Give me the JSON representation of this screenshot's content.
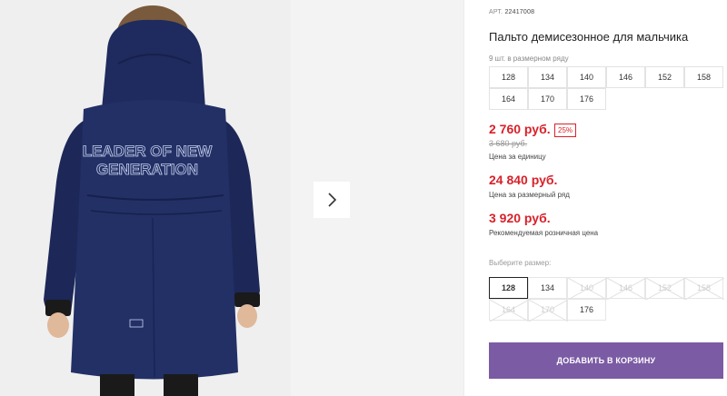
{
  "gallery": {
    "print_line1": "LEADER OF NEW",
    "print_line2": "GENERATION",
    "next_icon": "chevron-right-icon"
  },
  "product": {
    "art_label": "АРТ.",
    "art_number": "22417008",
    "title": "Пальто демисезонное для мальчика",
    "qty_note": "9 шт. в размерном ряду",
    "sizes": [
      "128",
      "134",
      "140",
      "146",
      "152",
      "158",
      "164",
      "170",
      "176"
    ]
  },
  "pricing": {
    "unit_price": "2 760 руб.",
    "discount": "25%",
    "old_price": "3 680 руб.",
    "unit_caption": "Цена за единицу",
    "row_price": "24 840 руб.",
    "row_caption": "Цена за размерный ряд",
    "retail_price": "3 920 руб.",
    "retail_caption": "Рекомендуемая розничная цена",
    "accent_color": "#d8212a"
  },
  "size_picker": {
    "label": "Выберите размер:",
    "options": [
      {
        "size": "128",
        "state": "selected"
      },
      {
        "size": "134",
        "state": "available"
      },
      {
        "size": "140",
        "state": "unavailable"
      },
      {
        "size": "146",
        "state": "unavailable"
      },
      {
        "size": "152",
        "state": "unavailable"
      },
      {
        "size": "158",
        "state": "unavailable"
      },
      {
        "size": "164",
        "state": "unavailable"
      },
      {
        "size": "170",
        "state": "unavailable"
      },
      {
        "size": "176",
        "state": "available"
      }
    ]
  },
  "cart": {
    "button_label": "ДОБАВИТЬ В КОРЗИНУ",
    "button_color": "#7b5ba4"
  }
}
